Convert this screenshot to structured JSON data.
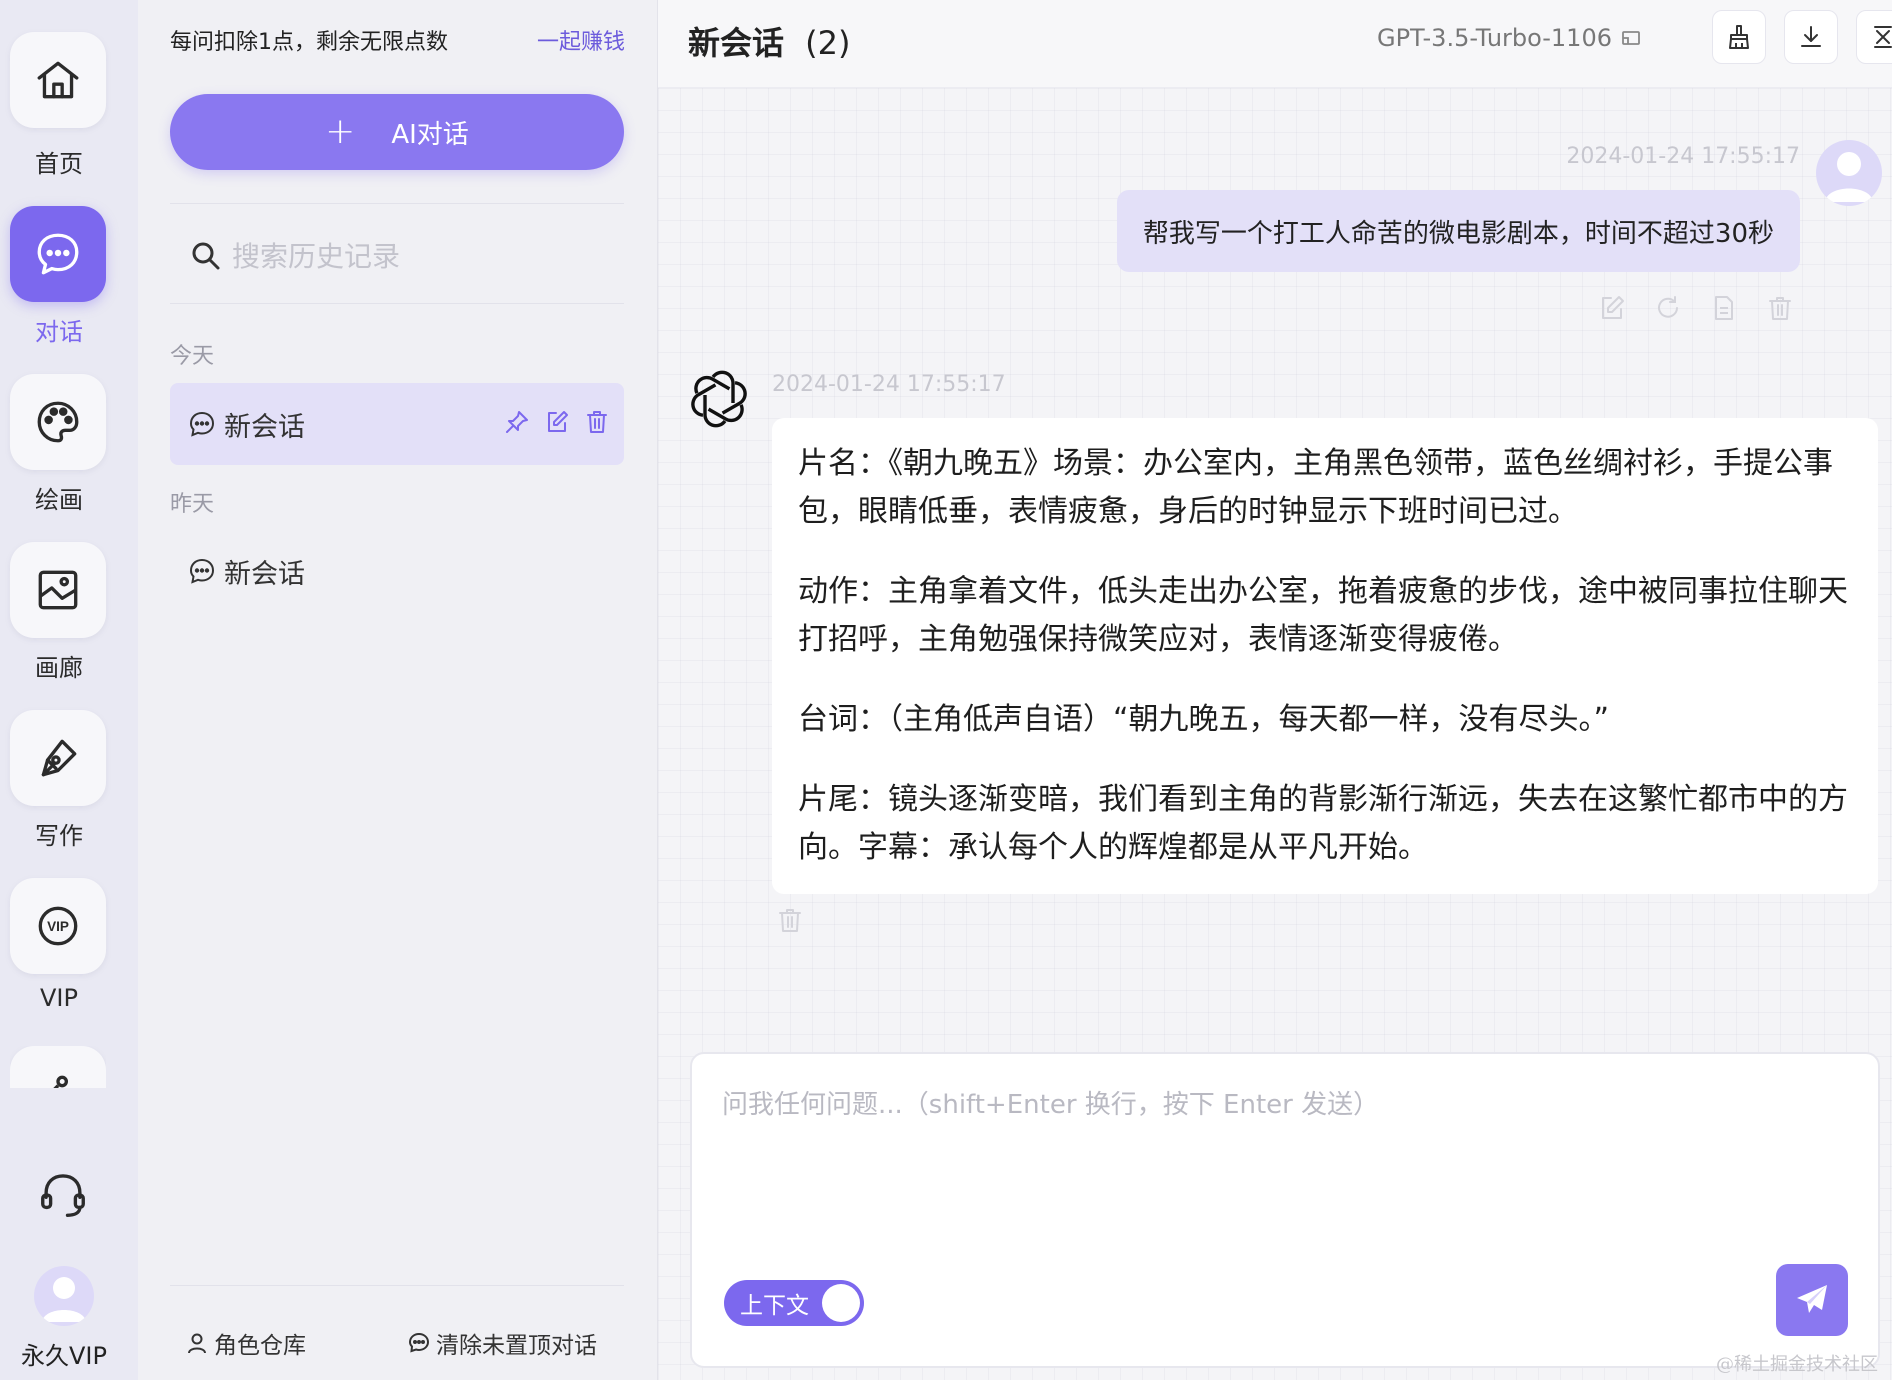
{
  "rail": {
    "items": [
      {
        "label": "首页",
        "icon": "home-icon"
      },
      {
        "label": "对话",
        "icon": "chat-icon",
        "active": true
      },
      {
        "label": "绘画",
        "icon": "palette-icon"
      },
      {
        "label": "画廊",
        "icon": "gallery-icon"
      },
      {
        "label": "写作",
        "icon": "pen-icon"
      },
      {
        "label": "VIP",
        "icon": "vip-icon"
      }
    ],
    "account_label": "永久VIP"
  },
  "panel": {
    "points_text": "每问扣除1点，剩余无限点数",
    "earn_link": "一起赚钱",
    "new_chat_label": "AI对话",
    "search_placeholder": "搜索历史记录",
    "groups": [
      {
        "label": "今天",
        "conversations": [
          {
            "title": "新会话",
            "active": true
          }
        ]
      },
      {
        "label": "昨天",
        "conversations": [
          {
            "title": "新会话",
            "active": false
          }
        ]
      }
    ],
    "footer": {
      "roles": "角色仓库",
      "clear": "清除未置顶对话"
    }
  },
  "chat": {
    "title": "新会话",
    "count": "(2)",
    "model": "GPT-3.5-Turbo-1106",
    "messages": [
      {
        "role": "user",
        "time": "2024-01-24 17:55:17",
        "text": "帮我写一个打工人命苦的微电影剧本，时间不超过30秒"
      },
      {
        "role": "assistant",
        "time": "2024-01-24 17:55:17",
        "paragraphs": [
          "片名：《朝九晚五》场景：办公室内，主角黑色领带，蓝色丝绸衬衫，手提公事包，眼睛低垂，表情疲惫，身后的时钟显示下班时间已过。",
          "动作：主角拿着文件，低头走出办公室，拖着疲惫的步伐，途中被同事拉住聊天打招呼，主角勉强保持微笑应对，表情逐渐变得疲倦。",
          "台词：（主角低声自语）“朝九晚五，每天都一样，没有尽头。”",
          "片尾：镜头逐渐变暗，我们看到主角的背影渐行渐远，失去在这繁忙都市中的方向。字幕：承认每个人的辉煌都是从平凡开始。"
        ]
      }
    ],
    "input_placeholder": "问我任何问题...（shift+Enter 换行，按下 Enter 发送）",
    "context_label": "上下文"
  },
  "watermark": "@稀土掘金技术社区",
  "colors": {
    "accent": "#7c68ee",
    "accent_light": "#e3e0f8",
    "bg": "#f4f4f7"
  }
}
